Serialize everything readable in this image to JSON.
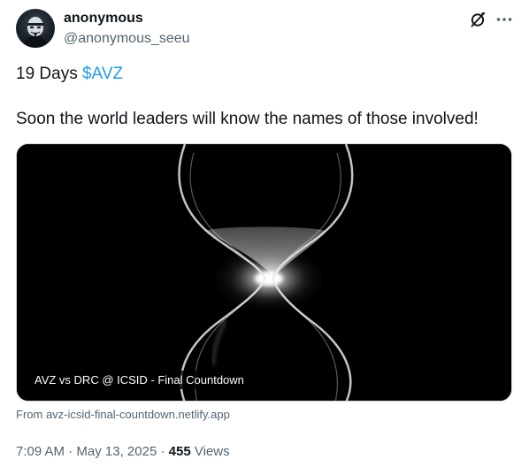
{
  "author": {
    "name": "anonymous",
    "handle": "@anonymous_seeu",
    "avatar_icon": "masked-figure-avatar-icon"
  },
  "header_actions": {
    "grok_icon": "grok-slash-circle-icon",
    "more_icon": "more-dots-icon"
  },
  "tweet": {
    "line1_text": "19 Days ",
    "cashtag": "$AVZ",
    "line2_text": "Soon the world leaders will know the names of those involved!"
  },
  "card": {
    "title": "AVZ vs DRC @ ICSID - Final Countdown",
    "source": "From avz-icsid-final-countdown.netlify.app",
    "image_icon": "hourglass-icon"
  },
  "meta": {
    "time": "7:09 AM",
    "separator1": " · ",
    "date": "May 13, 2025",
    "separator2": " · ",
    "views_count": "455",
    "views_label": " Views"
  },
  "colors": {
    "text_primary": "#0f1419",
    "text_secondary": "#536471",
    "link": "#1d9bf0",
    "card_background": "#000000"
  }
}
